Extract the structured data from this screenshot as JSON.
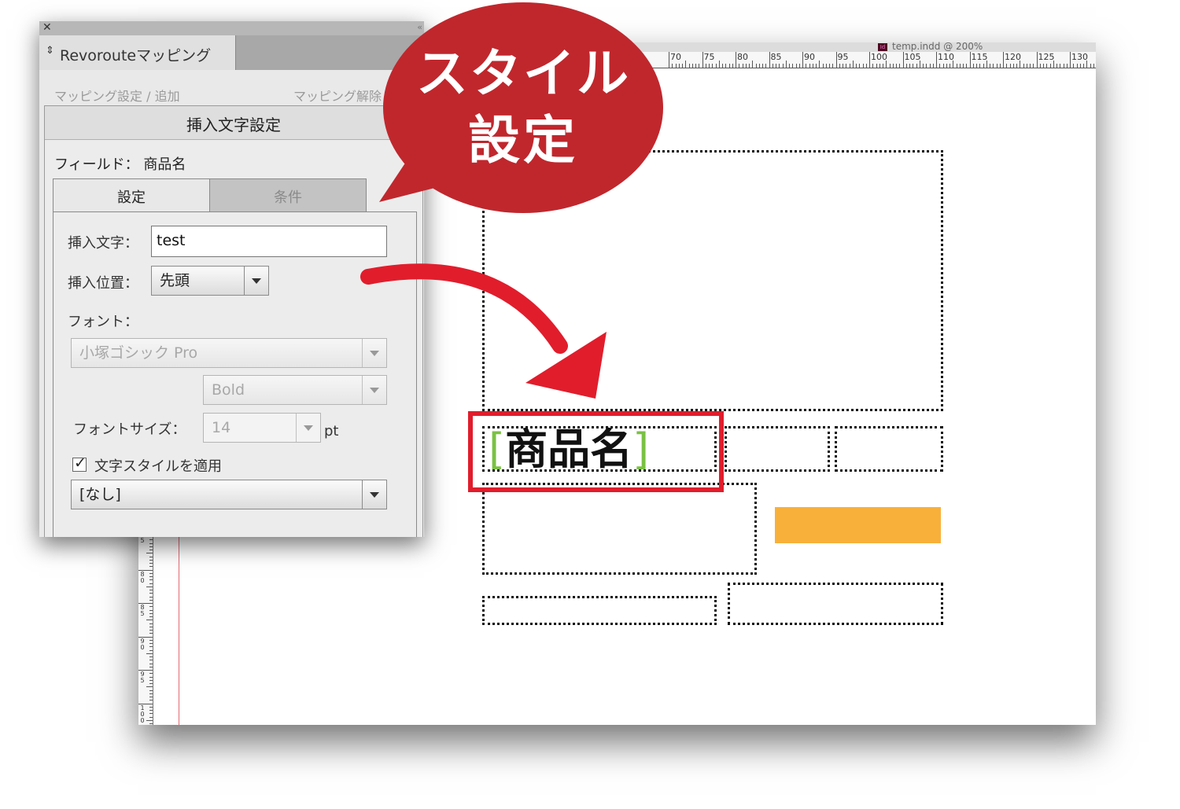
{
  "document": {
    "title": "temp.indd @ 200%",
    "ruler_labels": [
      "70",
      "75",
      "80",
      "85",
      "90",
      "95",
      "100",
      "105",
      "110",
      "115",
      "120",
      "125",
      "130"
    ],
    "vruler_labels": [
      "5",
      "80",
      "85",
      "90",
      "95",
      "100"
    ],
    "product_field": "商品名"
  },
  "panel": {
    "tab_label": "Revorouteマッピング",
    "menu": {
      "mapping_settings": "マッピング設定 / 追加",
      "mapping_release": "マッピング解除"
    },
    "section_title": "挿入文字設定",
    "field_label": "フィールド： 商品名",
    "tabs": {
      "settings": "設定",
      "conditions": "条件"
    },
    "insert_text_label": "挿入文字：",
    "insert_text_value": "test",
    "insert_position_label": "挿入位置：",
    "insert_position_value": "先頭",
    "font_label": "フォント：",
    "font_family": "小塚ゴシック Pro",
    "font_style": "Bold",
    "font_size_label": "フォントサイズ：",
    "font_size_value": "14",
    "font_size_unit": "pt",
    "apply_style_label": "文字スタイルを適用",
    "apply_style_checked": true,
    "char_style_value": "[なし]"
  },
  "callout": {
    "line1": "スタイル",
    "line2": "設定",
    "color": "#c0272d"
  },
  "colors": {
    "arrow": "#e11d2c",
    "highlight": "#e11d2c",
    "orange_block": "#f8b03a",
    "bracket": "#7ac143"
  }
}
